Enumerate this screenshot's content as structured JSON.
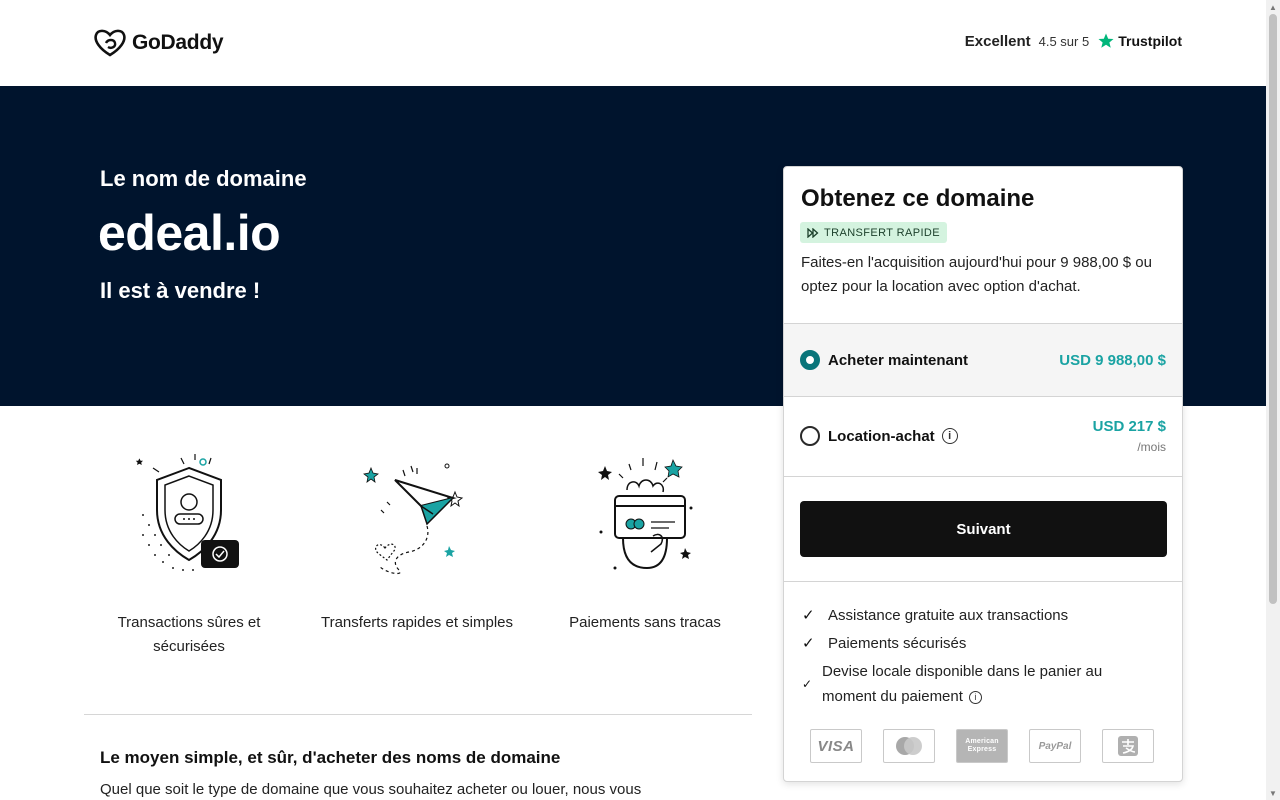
{
  "header": {
    "logo_text": "GoDaddy",
    "trust_rating_word": "Excellent",
    "trust_score": "4.5 sur 5",
    "trust_brand": "Trustpilot"
  },
  "hero": {
    "intro": "Le nom de domaine",
    "domain": "edeal.io",
    "sale_text": "Il est à vendre !"
  },
  "features": [
    {
      "label": "Transactions sûres et sécurisées",
      "icon": "shield-icon"
    },
    {
      "label": "Transferts rapides et simples",
      "icon": "paper-plane-icon"
    },
    {
      "label": "Paiements sans tracas",
      "icon": "card-in-hand-icon"
    }
  ],
  "info_section": {
    "title": "Le moyen simple, et sûr, d'acheter des noms de domaine",
    "text": "Quel que soit le type de domaine que vous souhaitez acheter ou louer, nous vous"
  },
  "card": {
    "title": "Obtenez ce domaine",
    "badge": "TRANSFERT RAPIDE",
    "description": "Faites-en l'acquisition aujourd'hui pour 9 988,00 $ ou optez pour la location avec option d'achat.",
    "options": [
      {
        "label": "Acheter maintenant",
        "price": "USD 9 988,00 $",
        "unit": "",
        "selected": true
      },
      {
        "label": "Location-achat",
        "price": "USD 217 $",
        "unit": "/mois",
        "selected": false
      }
    ],
    "next_button": "Suivant",
    "benefits": [
      "Assistance gratuite aux transactions",
      "Paiements sécurisés",
      "Devise locale disponible dans le panier au moment du paiement"
    ],
    "payment_methods": [
      "VISA",
      "Mastercard",
      "American Express",
      "PayPal",
      "Alipay"
    ]
  },
  "colors": {
    "hero_bg": "#00142d",
    "accent_teal": "#1aa3a3",
    "radio_selected": "#09757a",
    "badge_bg": "#d4f3df",
    "button_bg": "#111111"
  }
}
